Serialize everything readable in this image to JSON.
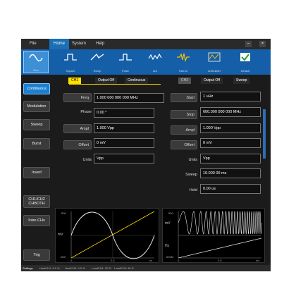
{
  "menu": {
    "file": "File",
    "home": "Home",
    "system": "System",
    "help": "Help",
    "minimize": "–",
    "close": "×"
  },
  "toolbar": {
    "sine": "Sine",
    "square": "Square",
    "ramp": "Ramp",
    "pulse": "Pulse",
    "arb": "Arb",
    "harmonic": "Harmo",
    "arbbuilder": "Arbbuilder",
    "default": "Default"
  },
  "side": {
    "continuous": "Continuous",
    "modulation": "Modulation",
    "sweep": "Sweep",
    "burst": "Burst",
    "invert": "Invert",
    "ch1ch2_line1": "CH1/CH2",
    "ch1ch2_line2": "CHBOTH",
    "interch": "Inter-CHs",
    "trig": "Trig"
  },
  "ch1": {
    "tag": "CH1",
    "output": "Output Off",
    "mode": "Continuous",
    "params": [
      {
        "label": "Freq",
        "value": "1.000 000 000 000 MHz"
      },
      {
        "label": "Phase",
        "value": "0.00 °"
      },
      {
        "label": "Ampl",
        "value": "1.000 Vpp"
      },
      {
        "label": "Offset",
        "value": "0 mV"
      },
      {
        "label": "Units",
        "value": "Vpp"
      }
    ],
    "plot": {
      "ylabel": "mV",
      "ytop": "500",
      "ybot": "-500",
      "x0": "0",
      "x1": "0.5",
      "x2": "us"
    }
  },
  "ch2": {
    "tag": "CH2",
    "output": "Output Off",
    "mode": "Sweep",
    "params": [
      {
        "label": "Start",
        "value": "1 uHz"
      },
      {
        "label": "Stop",
        "value": "600.000 000 000 MHz"
      },
      {
        "label": "Ampl",
        "value": "1.000 Vpp"
      },
      {
        "label": "Offset",
        "value": "0 mV"
      },
      {
        "label": "Units",
        "value": "Vpp"
      },
      {
        "label": "Sweep",
        "value": "10.000 00 ms"
      },
      {
        "label": "Hold",
        "value": "0.00 us"
      }
    ],
    "plot": {
      "ylabel": "mV",
      "ylabel2": "Hz",
      "ytop": "500",
      "ybot": "600M",
      "x0": "0",
      "x1": "0.5",
      "x2": "ms"
    }
  },
  "status": {
    "mode": "Settings",
    "hoste": "HostCH1: 0.0 %",
    "host2": "HostCH2: 0.0 %",
    "load1": "LoadCH1: 50 Ω",
    "load2": "LoadCH2: 50 Ω"
  },
  "colors": {
    "accent": "#1e7fcf",
    "toolbar": "#155fa8",
    "ch1": "#ffe000",
    "wave": "#e8e8e8"
  }
}
